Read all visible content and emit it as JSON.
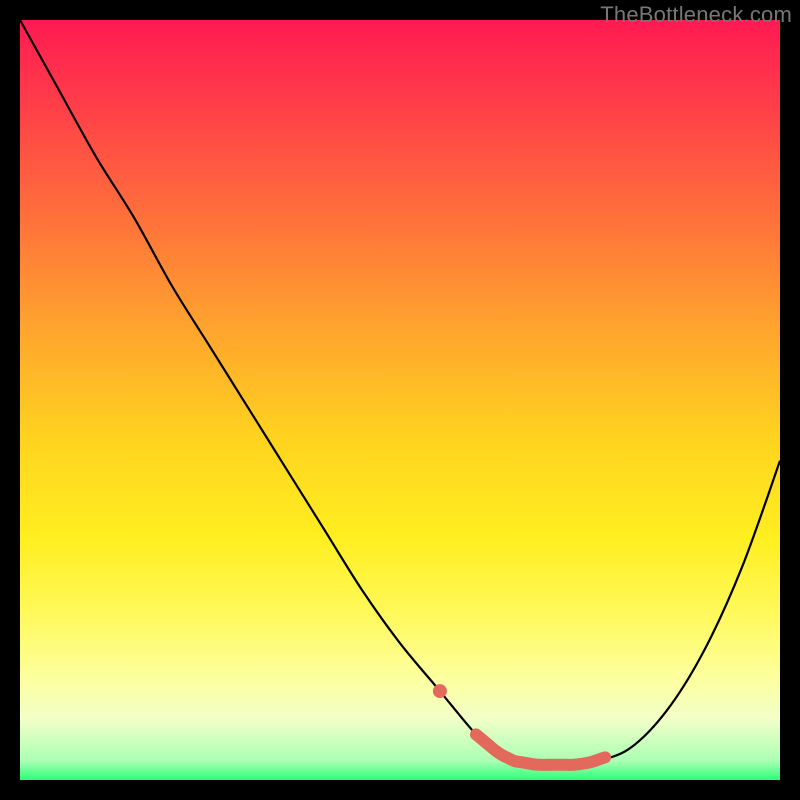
{
  "watermark": {
    "text": "TheBottleneck.com"
  },
  "chart_data": {
    "type": "line",
    "title": "",
    "xlabel": "",
    "ylabel": "",
    "xlim": [
      0,
      100
    ],
    "ylim": [
      0,
      100
    ],
    "x": [
      0,
      5,
      10,
      15,
      20,
      25,
      30,
      35,
      40,
      45,
      50,
      55,
      60,
      63,
      65,
      68,
      70,
      73,
      75,
      80,
      85,
      90,
      95,
      100
    ],
    "values": [
      100,
      91,
      82,
      74,
      65,
      57,
      49,
      41,
      33,
      25,
      18,
      12,
      6,
      3.5,
      2.5,
      2,
      2,
      2,
      2.3,
      4,
      9,
      17,
      28,
      42
    ],
    "highlight_ranges": [
      {
        "x": [
          54,
          56.5
        ],
        "kind": "dot"
      },
      {
        "x": [
          60,
          77
        ],
        "kind": "segment"
      }
    ],
    "background_gradient": {
      "direction": "vertical",
      "stops": [
        {
          "pos": 0.0,
          "color": "#ff1a52"
        },
        {
          "pos": 0.1,
          "color": "#ff3a4a"
        },
        {
          "pos": 0.25,
          "color": "#ff6d3c"
        },
        {
          "pos": 0.4,
          "color": "#ffa22e"
        },
        {
          "pos": 0.55,
          "color": "#ffd31f"
        },
        {
          "pos": 0.68,
          "color": "#ffee20"
        },
        {
          "pos": 0.78,
          "color": "#fff95a"
        },
        {
          "pos": 0.86,
          "color": "#fdff9a"
        },
        {
          "pos": 0.92,
          "color": "#f2ffc8"
        },
        {
          "pos": 0.975,
          "color": "#aaffb4"
        },
        {
          "pos": 1.0,
          "color": "#2bff77"
        }
      ]
    }
  }
}
